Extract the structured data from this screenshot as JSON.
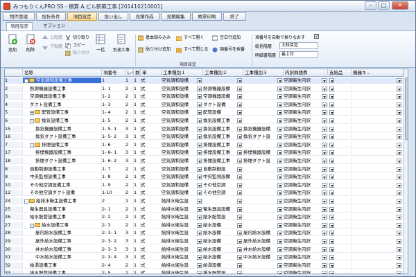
{
  "window": {
    "title": "みつもりくんPRO SS - 積算  A.ビル新築工事 [201410210001]"
  },
  "menu": [
    {
      "label": "物件管理"
    },
    {
      "label": "拾折条件"
    },
    {
      "label": "項目設定"
    },
    {
      "label": "拾い出し"
    },
    {
      "label": "見積作成"
    },
    {
      "label": "見積編集"
    },
    {
      "label": "帳票印刷"
    },
    {
      "label": "終了"
    }
  ],
  "ribbon_tabs": [
    {
      "label": "項目設定"
    },
    {
      "label": "オプション"
    }
  ],
  "ribbon": {
    "add": "追加",
    "delete": "削除",
    "move_up": "上階層",
    "move_down": "下階層",
    "cut": "切り取り",
    "copy": "コピー",
    "paste": "貼り付け",
    "single": "一括",
    "set_all": "別途工事",
    "basic_read": "基本読み込み",
    "paste_add": "貼り付け追加",
    "open_all": "すべて開く",
    "close_all": "すべて閉じる",
    "insert_blank": "空白行追加",
    "renumber": "項番号を採番",
    "group_label": "項目設定",
    "auto_number_label": "項番号を自動で振りなおす",
    "total_level_label": "総括階層",
    "total_level_value": "大科目迄",
    "detail_level_label": "明細書階層",
    "detail_level_value": "最上位",
    "auto_checked": "☑"
  },
  "columns": [
    "名称",
    "項番号",
    "レベル",
    "数",
    "単",
    "工事種別１",
    "工事種別２",
    "工事種別３",
    "内訳問題費",
    "支給品",
    "機器キ..."
  ],
  "rows": [
    {
      "no": "1",
      "name": "空気調和設備工事",
      "code": "1",
      "lv": "1",
      "qty": "1",
      "unit": "式",
      "k1": "空気調和設備",
      "k2": "",
      "k3": "",
      "ut": "空調衛生内訳",
      "indent": 0,
      "folder": true,
      "exp": "-"
    },
    {
      "no": "2",
      "name": "熱源機器設備工事",
      "code": "1- 1",
      "lv": "2",
      "qty": "1",
      "unit": "式",
      "k1": "空気調和設備",
      "k2": "熱源機器設備",
      "k3": "",
      "ut": "空調衛生内訳",
      "indent": 1
    },
    {
      "no": "3",
      "name": "空調機器設備工事",
      "code": "1- 2",
      "lv": "2",
      "qty": "1",
      "unit": "式",
      "k1": "空気調和設備",
      "k2": "空調機器設備",
      "k3": "",
      "ut": "空調衛生内訳",
      "indent": 1
    },
    {
      "no": "4",
      "name": "ダクト設備工事",
      "code": "1- 3",
      "lv": "2",
      "qty": "1",
      "unit": "式",
      "k1": "空気調和設備",
      "k2": "ダクト設備",
      "k3": "",
      "ut": "空調衛生内訳",
      "indent": 1
    },
    {
      "no": "5",
      "name": "配管設備工事",
      "code": "1- 4",
      "lv": "2",
      "qty": "1",
      "unit": "式",
      "k1": "空気調和設備",
      "k2": "配管設備",
      "k3": "",
      "ut": "空調衛生内訳",
      "indent": 1,
      "folder": true,
      "exp": "+"
    },
    {
      "no": "6",
      "name": "換気設備工事",
      "code": "1- 5",
      "lv": "2",
      "qty": "1",
      "unit": "式",
      "k1": "空気調和設備",
      "k2": "換気設備工事",
      "k3": "",
      "ut": "空調衛生内訳",
      "indent": 1,
      "folder": true,
      "exp": "-"
    },
    {
      "no": "15",
      "name": "換気機器設備工事",
      "code": "1- 5- 1",
      "lv": "3",
      "qty": "1",
      "unit": "式",
      "k1": "空気調和設備",
      "k2": "換気設備工事",
      "k3": "換気機器設備",
      "ut": "空調衛生内訳",
      "indent": 2
    },
    {
      "no": "16",
      "name": "換気ダクト設備工事",
      "code": "1- 5- 2",
      "lv": "3",
      "qty": "1",
      "unit": "式",
      "k1": "空気調和設備",
      "k2": "換気設備工事",
      "k3": "換気ダクト設",
      "ut": "空調衛生内訳",
      "indent": 2
    },
    {
      "no": "7",
      "name": "排煙設備工事",
      "code": "1- 6",
      "lv": "2",
      "qty": "1",
      "unit": "式",
      "k1": "空気調和設備",
      "k2": "排煙設備工事",
      "k3": "",
      "ut": "空調衛生内訳",
      "indent": 1,
      "folder": true,
      "exp": "-"
    },
    {
      "no": "17",
      "name": "排煙機器設備工事",
      "code": "1- 6- 1",
      "lv": "3",
      "qty": "1",
      "unit": "式",
      "k1": "空気調和設備",
      "k2": "排煙設備工事",
      "k3": "排煙機器設備",
      "ut": "空調衛生内訳",
      "indent": 2
    },
    {
      "no": "18",
      "name": "排煙ダクト設備工事",
      "code": "1- 6- 2",
      "lv": "3",
      "qty": "1",
      "unit": "式",
      "k1": "空気調和設備",
      "k2": "排煙設備工事",
      "k3": "排煙ダクト設",
      "ut": "空調衛生内訳",
      "indent": 2
    },
    {
      "no": "8",
      "name": "自動制御設備工事",
      "code": "1- 7",
      "lv": "2",
      "qty": "1",
      "unit": "式",
      "k1": "空気調和設備",
      "k2": "自動制御設",
      "k3": "",
      "ut": "空調衛生内訳",
      "indent": 1
    },
    {
      "no": "9",
      "name": "中央監視設備工事",
      "code": "1- 8",
      "lv": "2",
      "qty": "1",
      "unit": "式",
      "k1": "空気調和設備",
      "k2": "中央監視設備",
      "k3": "",
      "ut": "空調衛生内訳",
      "indent": 1
    },
    {
      "no": "10",
      "name": "その他空調設備工事",
      "code": "1- 9",
      "lv": "2",
      "qty": "1",
      "unit": "式",
      "k1": "空気調和設備",
      "k2": "その他空調",
      "k3": "",
      "ut": "空調衛生内訳",
      "indent": 1
    },
    {
      "no": "12",
      "name": "その他空調ダクト設備",
      "code": "1-10",
      "lv": "2",
      "qty": "1",
      "unit": "式",
      "k1": "空気調和設備",
      "k2": "その他空調",
      "k3": "",
      "ut": "空調衛生内訳",
      "indent": 1
    },
    {
      "no": "24",
      "name": "給排水衛生設備工事",
      "code": "2",
      "lv": "1",
      "qty": "1",
      "unit": "式",
      "k1": "給排水衛生設",
      "k2": "",
      "k3": "",
      "ut": "空調衛生内訳",
      "indent": 0,
      "folder": true,
      "exp": "-"
    },
    {
      "no": "25",
      "name": "衛生器具設備工事",
      "code": "2- 1",
      "lv": "2",
      "qty": "1",
      "unit": "式",
      "k1": "給排水衛生設",
      "k2": "衛生器具設備",
      "k3": "",
      "ut": "空調衛生内訳",
      "indent": 1
    },
    {
      "no": "26",
      "name": "給水配管設備工事",
      "code": "2- 2",
      "lv": "2",
      "qty": "1",
      "unit": "式",
      "k1": "給排水衛生設",
      "k2": "給水配管設",
      "k3": "",
      "ut": "空調衛生内訳",
      "indent": 1
    },
    {
      "no": "27",
      "name": "給水設備工事",
      "code": "2- 3",
      "lv": "2",
      "qty": "1",
      "unit": "式",
      "k1": "給排水衛生設",
      "k2": "給水設備",
      "k3": "",
      "ut": "空調衛生内訳",
      "indent": 1,
      "folder": true,
      "exp": "-"
    },
    {
      "no": "28",
      "name": "屋内給水設備工事",
      "code": "2- 3- 1",
      "lv": "3",
      "qty": "1",
      "unit": "式",
      "k1": "給排水衛生設",
      "k2": "給水設備",
      "k3": "屋内給水設備",
      "ut": "空調衛生内訳",
      "indent": 2
    },
    {
      "no": "29",
      "name": "屋外給水設備工事",
      "code": "2- 3- 2",
      "lv": "3",
      "qty": "1",
      "unit": "式",
      "k1": "給排水衛生設",
      "k2": "給水設備",
      "k3": "屋外給水設備",
      "ut": "空調衛生内訳",
      "indent": 2
    },
    {
      "no": "30",
      "name": "井水給水設備工事",
      "code": "2- 3- 3",
      "lv": "3",
      "qty": "1",
      "unit": "式",
      "k1": "給排水衛生設",
      "k2": "給水設備",
      "k3": "井水給水設備",
      "ut": "空調衛生内訳",
      "indent": 2
    },
    {
      "no": "31",
      "name": "中水給水設備工事",
      "code": "2- 3- 4",
      "lv": "3",
      "qty": "1",
      "unit": "式",
      "k1": "給排水衛生設",
      "k2": "給水設備",
      "k3": "中水給水設備",
      "ut": "空調衛生内訳",
      "indent": 2
    },
    {
      "no": "32",
      "name": "給湯設備工事",
      "code": "2- 4",
      "lv": "2",
      "qty": "1",
      "unit": "式",
      "k1": "給排水衛生設",
      "k2": "給湯設備",
      "k3": "",
      "ut": "空調衛生内訳",
      "indent": 1
    },
    {
      "no": "33",
      "name": "排水配管設備工事",
      "code": "2- 5",
      "lv": "2",
      "qty": "1",
      "unit": "式",
      "k1": "給排水衛生設",
      "k2": "排水配管設",
      "k3": "",
      "ut": "空調衛生内訳",
      "indent": 1
    }
  ]
}
